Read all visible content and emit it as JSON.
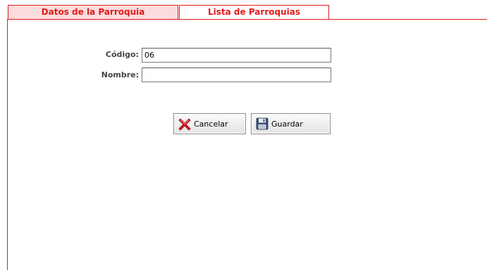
{
  "tabs": {
    "datos_label": "Datos de la Parroquia",
    "lista_label": "Lista de Parroquias"
  },
  "form": {
    "codigo_label": "Código:",
    "codigo_value": "06",
    "nombre_label": "Nombre:",
    "nombre_value": ""
  },
  "buttons": {
    "cancel_label": "Cancelar",
    "cancel_icon": "red-x-icon",
    "save_label": "Guardar",
    "save_icon": "floppy-disk-icon"
  },
  "colors": {
    "accent": "#e11b1b",
    "active_tab_bg": "#fbdcdc"
  }
}
